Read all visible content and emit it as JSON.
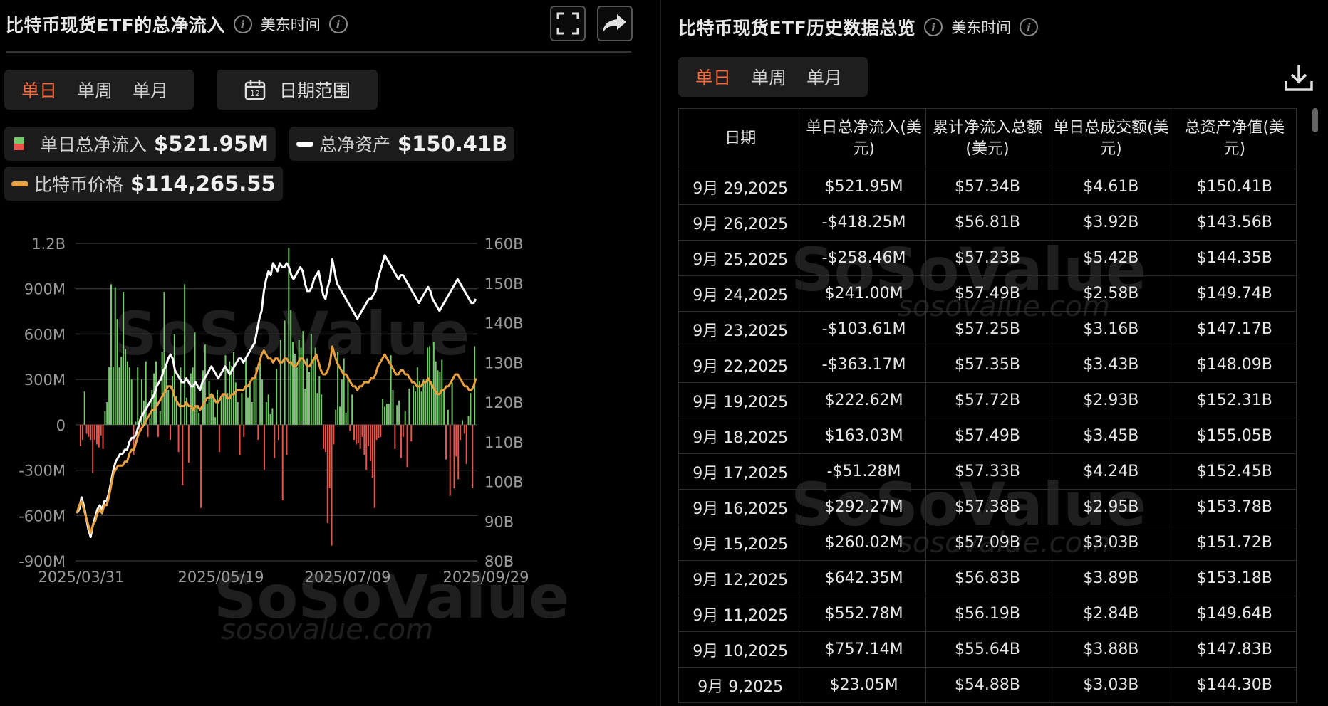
{
  "left": {
    "title": "比特币现货ETF的总净流入",
    "timezone": "美东时间",
    "tabs": [
      "单日",
      "单周",
      "单月"
    ],
    "date_range": "日期范围",
    "legend": [
      {
        "label": "单日总净流入",
        "value": "$521.95M"
      },
      {
        "label": "总净资产",
        "value": "$150.41B"
      },
      {
        "label": "比特币价格",
        "value": "$114,265.55"
      }
    ],
    "watermark_domain": "sosovalue.com"
  },
  "right": {
    "title": "比特币现货ETF历史数据总览",
    "timezone": "美东时间",
    "tabs": [
      "单日",
      "单周",
      "单月"
    ],
    "columns": [
      "日期",
      "单日总净流入(美元)",
      "累计净流入总额(美元)",
      "单日总成交额(美元)",
      "总资产净值(美元)"
    ],
    "rows": [
      [
        "9月 29,2025",
        "$521.95M",
        "$57.34B",
        "$4.61B",
        "$150.41B"
      ],
      [
        "9月 26,2025",
        "-$418.25M",
        "$56.81B",
        "$3.92B",
        "$143.56B"
      ],
      [
        "9月 25,2025",
        "-$258.46M",
        "$57.23B",
        "$5.42B",
        "$144.35B"
      ],
      [
        "9月 24,2025",
        "$241.00M",
        "$57.49B",
        "$2.58B",
        "$149.74B"
      ],
      [
        "9月 23,2025",
        "-$103.61M",
        "$57.25B",
        "$3.16B",
        "$147.17B"
      ],
      [
        "9月 22,2025",
        "-$363.17M",
        "$57.35B",
        "$3.43B",
        "$148.09B"
      ],
      [
        "9月 19,2025",
        "$222.62M",
        "$57.72B",
        "$2.93B",
        "$152.31B"
      ],
      [
        "9月 18,2025",
        "$163.03M",
        "$57.49B",
        "$3.45B",
        "$155.05B"
      ],
      [
        "9月 17,2025",
        "-$51.28M",
        "$57.33B",
        "$4.24B",
        "$152.45B"
      ],
      [
        "9月 16,2025",
        "$292.27M",
        "$57.38B",
        "$2.95B",
        "$153.78B"
      ],
      [
        "9月 15,2025",
        "$260.02M",
        "$57.09B",
        "$3.03B",
        "$151.72B"
      ],
      [
        "9月 12,2025",
        "$642.35M",
        "$56.83B",
        "$3.89B",
        "$153.18B"
      ],
      [
        "9月 11,2025",
        "$552.78M",
        "$56.19B",
        "$2.84B",
        "$149.64B"
      ],
      [
        "9月 10,2025",
        "$757.14M",
        "$55.64B",
        "$3.88B",
        "$147.83B"
      ],
      [
        "9月 9,2025",
        "$23.05M",
        "$54.88B",
        "$3.03B",
        "$144.30B"
      ]
    ],
    "watermark_domain": "sosovalue.com"
  },
  "colors": {
    "inflow_positive": "#74c96a",
    "inflow_negative": "#e8534a",
    "net_assets_line": "#ffffff",
    "btc_price_line": "#e8a040",
    "active_tab": "#ff6a3d"
  },
  "chart_data": {
    "type": "bar",
    "x_ticks": [
      "2025/03/31",
      "2025/05/19",
      "2025/07/09",
      "2025/09/29"
    ],
    "x_range": [
      "2025/03/31",
      "2025/09/29"
    ],
    "y_left_ticks": [
      "1.2B",
      "900M",
      "600M",
      "300M",
      "0",
      "-300M",
      "-600M",
      "-900M"
    ],
    "y_left_range": [
      -900,
      1200
    ],
    "y_left_unit": "M",
    "y_right_ticks": [
      "160B",
      "150B",
      "140B",
      "130B",
      "120B",
      "110B",
      "100B",
      "90B",
      "80B"
    ],
    "y_right_range": [
      80,
      160
    ],
    "series": [
      {
        "name": "单日总净流入",
        "type": "bar",
        "values": [
          -140,
          -100,
          220,
          -60,
          -80,
          -100,
          -320,
          -100,
          -130,
          -150,
          -70,
          -160,
          90,
          150,
          380,
          930,
          380,
          910,
          700,
          380,
          450,
          880,
          500,
          420,
          380,
          300,
          -200,
          20,
          380,
          -50,
          300,
          160,
          420,
          -80,
          40,
          230,
          340,
          420,
          -80,
          90,
          480,
          880,
          400,
          230,
          -100,
          320,
          600,
          190,
          -180,
          380,
          -400,
          930,
          180,
          -250,
          340,
          380,
          610,
          130,
          80,
          -550,
          360,
          530,
          140,
          290,
          200,
          200,
          50,
          230,
          -180,
          180,
          200,
          460,
          210,
          420,
          390,
          480,
          280,
          150,
          -200,
          210,
          -80,
          440,
          180,
          270,
          150,
          300,
          380,
          -100,
          410,
          300,
          -300,
          150,
          200,
          70,
          110,
          -220,
          370,
          -100,
          560,
          -500,
          690,
          -200,
          1170,
          760,
          550,
          470,
          380,
          560,
          510,
          620,
          240,
          440,
          350,
          600,
          430,
          510,
          210,
          320,
          200,
          -160,
          -180,
          -650,
          -420,
          -800,
          -130,
          100,
          480,
          120,
          300,
          440,
          80,
          300,
          -40,
          200,
          -100,
          -130,
          -120,
          -160,
          -80,
          -200,
          -300,
          -140,
          -240,
          -350,
          -550,
          -100,
          -90,
          -80,
          170,
          120,
          140,
          140,
          460,
          230,
          -160,
          130,
          160,
          -220,
          -80,
          90,
          -280,
          240,
          -110,
          260,
          220,
          380,
          290,
          220,
          300,
          290,
          510,
          520,
          290,
          550,
          420,
          360,
          350,
          430,
          240,
          -230,
          100,
          -470,
          280,
          -420,
          -210,
          -360,
          -100,
          30,
          -60,
          -260,
          60,
          210,
          -420,
          520
        ],
        "color": "#74c96a"
      },
      {
        "name": "总净资产",
        "type": "line",
        "values": [
          92,
          93,
          96,
          94,
          91,
          88,
          86,
          89,
          91,
          93,
          94,
          93,
          95,
          95,
          97,
          100,
          103,
          105,
          106,
          107,
          107,
          108,
          108,
          110,
          111,
          111,
          112,
          114,
          116,
          117,
          118,
          119,
          120,
          121,
          122,
          124,
          125,
          126,
          128,
          129,
          131,
          132,
          131,
          128,
          127,
          126,
          125,
          125,
          126,
          125,
          124,
          124,
          125,
          124,
          123,
          125,
          126,
          127,
          128,
          129,
          128,
          127,
          126,
          127,
          128,
          129,
          128,
          127,
          128,
          129,
          130,
          131,
          131,
          130,
          131,
          132,
          133,
          134,
          135,
          138,
          141,
          143,
          148,
          151,
          153,
          152,
          155,
          154,
          153,
          155,
          154,
          154,
          155,
          154,
          152,
          151,
          152,
          153,
          154,
          153,
          150,
          148,
          148,
          149,
          151,
          152,
          153,
          150,
          147,
          146,
          149,
          151,
          156,
          153,
          150,
          149,
          148,
          147,
          146,
          145,
          144,
          143,
          142,
          141,
          142,
          143,
          144,
          145,
          146,
          146,
          147,
          148,
          151,
          153,
          155,
          157,
          156,
          155,
          154,
          153,
          152,
          151,
          152,
          152,
          151,
          150,
          149,
          148,
          147,
          146,
          145,
          146,
          147,
          148,
          149,
          148,
          146,
          145,
          144,
          143,
          144,
          145,
          146,
          147,
          148,
          149,
          150,
          151,
          150,
          149,
          148,
          147,
          146,
          145,
          145,
          146
        ],
        "color": "#ffffff"
      },
      {
        "name": "比特币价格",
        "type": "line",
        "unit_note": "plotted on right axis scale",
        "values": [
          92,
          94,
          95,
          93,
          91,
          89,
          87,
          89,
          90,
          92,
          93,
          92,
          94,
          94,
          96,
          99,
          102,
          103,
          104,
          104,
          104,
          105,
          105,
          107,
          108,
          108,
          110,
          112,
          113,
          114,
          115,
          116,
          117,
          118,
          118,
          119,
          120,
          121,
          122,
          123,
          124,
          124,
          123,
          121,
          120,
          119,
          119,
          119,
          120,
          119,
          119,
          118,
          119,
          119,
          118,
          119,
          120,
          121,
          121,
          122,
          121,
          120,
          120,
          121,
          122,
          122,
          121,
          121,
          122,
          122,
          123,
          123,
          123,
          123,
          124,
          124,
          125,
          126,
          126,
          128,
          130,
          132,
          133,
          132,
          131,
          131,
          130,
          131,
          131,
          130,
          130,
          131,
          131,
          130,
          130,
          129,
          129,
          130,
          131,
          131,
          130,
          129,
          129,
          130,
          131,
          132,
          130,
          128,
          127,
          127,
          128,
          130,
          134,
          132,
          130,
          129,
          128,
          127,
          127,
          126,
          125,
          124,
          124,
          123,
          124,
          124,
          125,
          125,
          125,
          126,
          126,
          127,
          129,
          130,
          131,
          132,
          131,
          130,
          129,
          128,
          127,
          127,
          128,
          128,
          127,
          127,
          126,
          125,
          125,
          124,
          124,
          124,
          125,
          125,
          126,
          125,
          124,
          123,
          122,
          122,
          123,
          123,
          124,
          124,
          125,
          126,
          127,
          127,
          126,
          125,
          124,
          124,
          123,
          123,
          124,
          126
        ],
        "color": "#e8a040"
      }
    ]
  }
}
